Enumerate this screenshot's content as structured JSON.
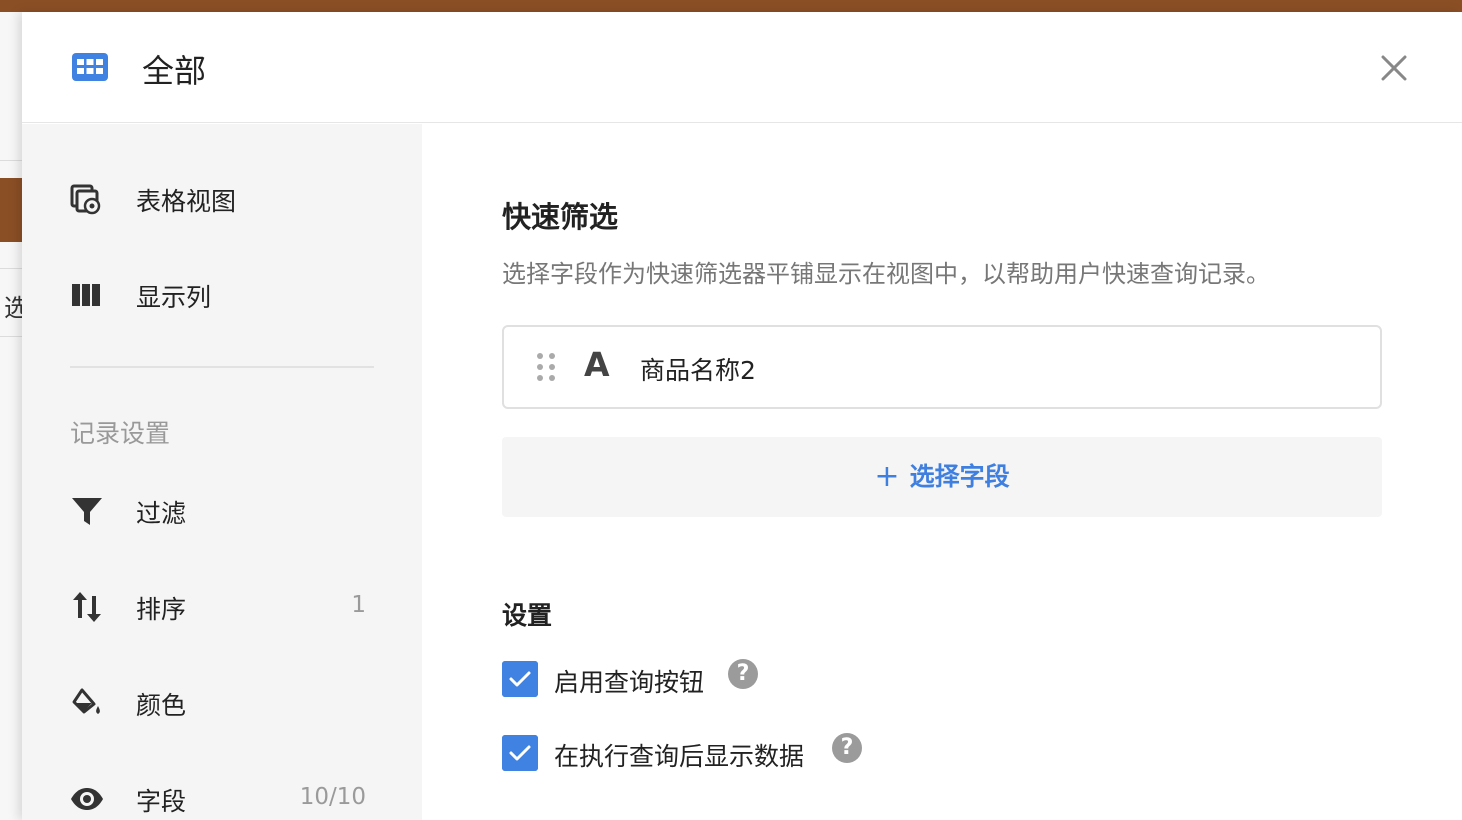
{
  "header": {
    "title": "全部",
    "view_icon": "grid-icon",
    "close_icon": "close-icon"
  },
  "background": {
    "partial_char": "选"
  },
  "sidebar": {
    "items_top": [
      {
        "label": "表格视图",
        "icon": "table-view-icon"
      },
      {
        "label": "显示列",
        "icon": "columns-icon"
      }
    ],
    "section_title": "记录设置",
    "items_record": [
      {
        "label": "过滤",
        "icon": "filter-icon",
        "count": ""
      },
      {
        "label": "排序",
        "icon": "sort-icon",
        "count": "1"
      },
      {
        "label": "颜色",
        "icon": "paint-bucket-icon",
        "count": ""
      },
      {
        "label": "字段",
        "icon": "eye-icon",
        "count": "10/10"
      }
    ]
  },
  "main": {
    "title": "快速筛选",
    "description": "选择字段作为快速筛选器平铺显示在视图中，以帮助用户快速查询记录。",
    "fields": [
      {
        "type_glyph": "A",
        "name": "商品名称2"
      }
    ],
    "add_field_plus": "+",
    "add_field_label": "选择字段",
    "settings_title": "设置",
    "options": [
      {
        "label": "启用查询按钮",
        "checked": true,
        "help": "?"
      },
      {
        "label": "在执行查询后显示数据",
        "checked": true,
        "help": "?"
      }
    ]
  },
  "colors": {
    "accent": "#3f82e2",
    "brand_brown": "#8b4f25",
    "sidebar_bg": "#f5f5f5"
  }
}
